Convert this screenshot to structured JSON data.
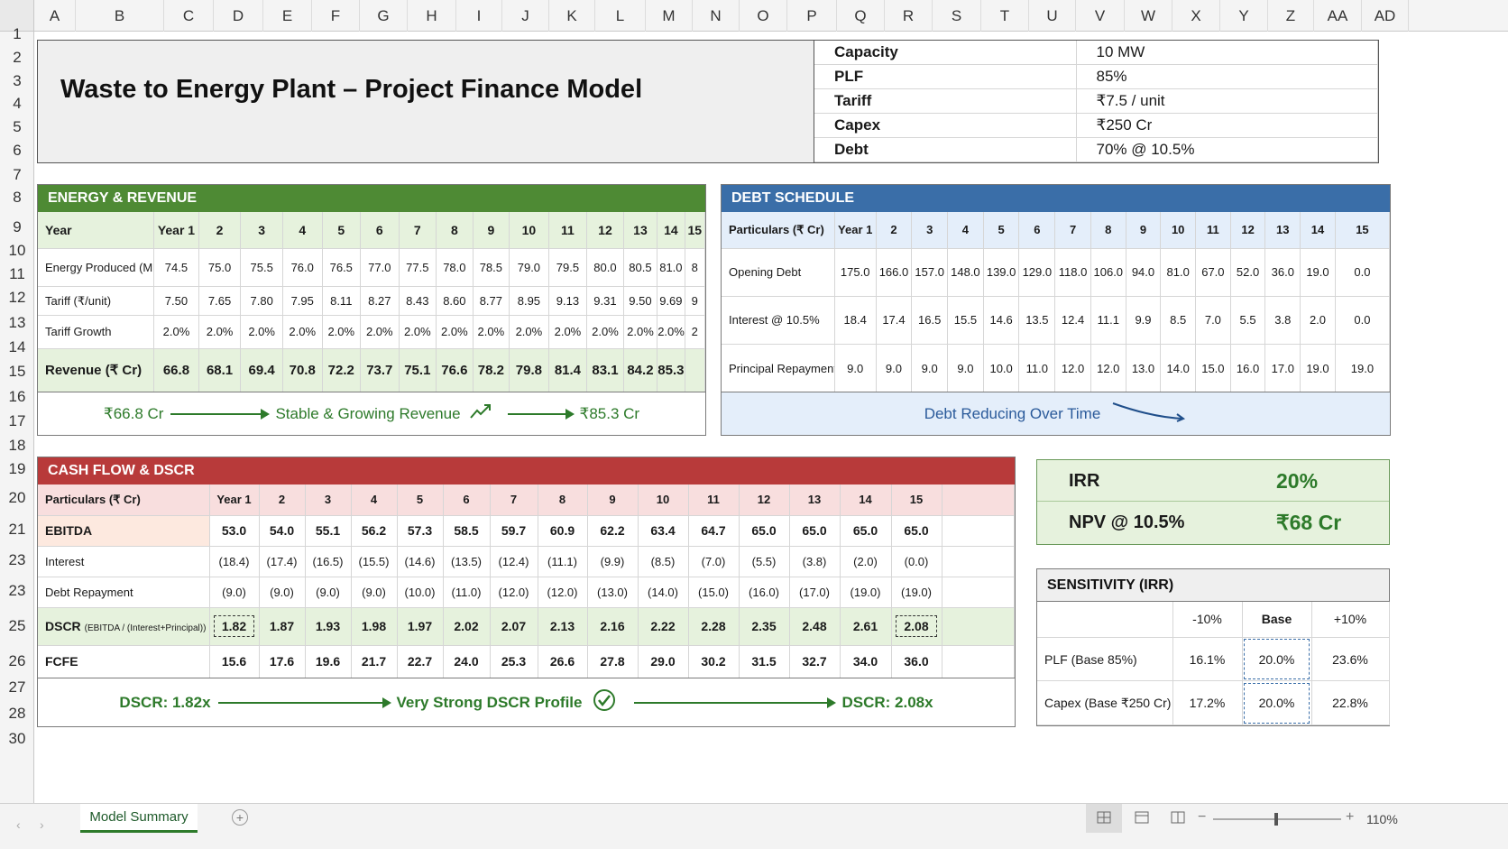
{
  "columns": [
    "A",
    "B",
    "C",
    "D",
    "E",
    "F",
    "G",
    "H",
    "I",
    "J",
    "K",
    "L",
    "M",
    "N",
    "O",
    "P",
    "Q",
    "R",
    "S",
    "T",
    "U",
    "V",
    "W",
    "X",
    "Y",
    "Z",
    "AA",
    "AD"
  ],
  "rows": [
    "1",
    "2",
    "3",
    "4",
    "5",
    "6",
    "7",
    "8",
    "9",
    "10",
    "11",
    "12",
    "13",
    "14",
    "15",
    "16",
    "17",
    "18",
    "19",
    "20",
    "21",
    "23",
    "23",
    "25",
    "26",
    "27",
    "28",
    "30"
  ],
  "title": "Waste to Energy Plant – Project Finance Model",
  "key_params": [
    {
      "label": "Capacity",
      "value": "10 MW"
    },
    {
      "label": "PLF",
      "value": "85%"
    },
    {
      "label": "Tariff",
      "value": "₹7.5 / unit"
    },
    {
      "label": "Capex",
      "value": "₹250 Cr"
    },
    {
      "label": "Debt",
      "value": "70% @ 10.5%"
    }
  ],
  "energy": {
    "header": "ENERGY & REVENUE",
    "cols": [
      "Year",
      "Year 1",
      "2",
      "3",
      "4",
      "5",
      "6",
      "7",
      "8",
      "9",
      "10",
      "11",
      "12",
      "13",
      "14",
      "15"
    ],
    "rows": [
      {
        "label": "Energy Produced (MU)",
        "values": [
          "74.5",
          "75.0",
          "75.5",
          "76.0",
          "76.5",
          "77.0",
          "77.5",
          "78.0",
          "78.5",
          "79.0",
          "79.5",
          "80.0",
          "80.5",
          "81.0",
          "8"
        ]
      },
      {
        "label": "Tariff (₹/unit)",
        "values": [
          "7.50",
          "7.65",
          "7.80",
          "7.95",
          "8.11",
          "8.27",
          "8.43",
          "8.60",
          "8.77",
          "8.95",
          "9.13",
          "9.31",
          "9.50",
          "9.69",
          "9"
        ]
      },
      {
        "label": "Tariff Growth",
        "values": [
          "2.0%",
          "2.0%",
          "2.0%",
          "2.0%",
          "2.0%",
          "2.0%",
          "2.0%",
          "2.0%",
          "2.0%",
          "2.0%",
          "2.0%",
          "2.0%",
          "2.0%",
          "2.0%",
          "2"
        ]
      }
    ],
    "revenue": {
      "label": "Revenue (₹ Cr)",
      "values": [
        "66.8",
        "68.1",
        "69.4",
        "70.8",
        "72.2",
        "73.7",
        "75.1",
        "76.6",
        "78.2",
        "79.8",
        "81.4",
        "83.1",
        "84.2",
        "85.3",
        ""
      ]
    },
    "footer": {
      "left": "₹66.8 Cr",
      "mid": "Stable & Growing Revenue",
      "right": "₹85.3 Cr",
      "icon": "trend-up-icon"
    }
  },
  "debt": {
    "header": "DEBT SCHEDULE",
    "cols": [
      "Particulars (₹ Cr)",
      "Year 1",
      "2",
      "3",
      "4",
      "5",
      "6",
      "7",
      "8",
      "9",
      "10",
      "11",
      "12",
      "13",
      "14",
      "15"
    ],
    "rows": [
      {
        "label": "Opening Debt",
        "values": [
          "175.0",
          "166.0",
          "157.0",
          "148.0",
          "139.0",
          "129.0",
          "118.0",
          "106.0",
          "94.0",
          "81.0",
          "67.0",
          "52.0",
          "36.0",
          "19.0",
          "0.0"
        ]
      },
      {
        "label": "Interest @ 10.5%",
        "values": [
          "18.4",
          "17.4",
          "16.5",
          "15.5",
          "14.6",
          "13.5",
          "12.4",
          "11.1",
          "9.9",
          "8.5",
          "7.0",
          "5.5",
          "3.8",
          "2.0",
          "0.0"
        ]
      },
      {
        "label": "Principal Repayment",
        "values": [
          "9.0",
          "9.0",
          "9.0",
          "9.0",
          "10.0",
          "11.0",
          "12.0",
          "12.0",
          "13.0",
          "14.0",
          "15.0",
          "16.0",
          "17.0",
          "19.0",
          "19.0"
        ]
      }
    ],
    "footer": "Debt Reducing Over Time",
    "icon": "trend-down-icon"
  },
  "cashflow": {
    "header": "CASH FLOW & DSCR",
    "cols": [
      "Particulars (₹ Cr)",
      "Year 1",
      "2",
      "3",
      "4",
      "5",
      "6",
      "7",
      "8",
      "9",
      "10",
      "11",
      "12",
      "13",
      "14",
      "15"
    ],
    "rows": [
      {
        "label": "EBITDA",
        "bold": true,
        "values": [
          "53.0",
          "54.0",
          "55.1",
          "56.2",
          "57.3",
          "58.5",
          "59.7",
          "60.9",
          "62.2",
          "63.4",
          "64.7",
          "65.0",
          "65.0",
          "65.0",
          "65.0"
        ]
      },
      {
        "label": "Interest",
        "values": [
          "(18.4)",
          "(17.4)",
          "(16.5)",
          "(15.5)",
          "(14.6)",
          "(13.5)",
          "(12.4)",
          "(11.1)",
          "(9.9)",
          "(8.5)",
          "(7.0)",
          "(5.5)",
          "(3.8)",
          "(2.0)",
          "(0.0)"
        ]
      },
      {
        "label": "Debt Repayment",
        "values": [
          "(9.0)",
          "(9.0)",
          "(9.0)",
          "(9.0)",
          "(10.0)",
          "(11.0)",
          "(12.0)",
          "(12.0)",
          "(13.0)",
          "(14.0)",
          "(15.0)",
          "(16.0)",
          "(17.0)",
          "(19.0)",
          "(19.0)"
        ]
      }
    ],
    "dscr": {
      "label": "DSCR",
      "note": "(EBITDA / (Interest+Principal))",
      "values": [
        "1.82",
        "1.87",
        "1.93",
        "1.98",
        "1.97",
        "2.02",
        "2.07",
        "2.13",
        "2.16",
        "2.22",
        "2.28",
        "2.35",
        "2.48",
        "2.61",
        "2.08"
      ]
    },
    "fcfe": {
      "label": "FCFE",
      "values": [
        "15.6",
        "17.6",
        "19.6",
        "21.7",
        "22.7",
        "24.0",
        "25.3",
        "26.6",
        "27.8",
        "29.0",
        "30.2",
        "31.5",
        "32.7",
        "34.0",
        "36.0"
      ]
    },
    "footer": {
      "left": "DSCR: 1.82x",
      "mid": "Very Strong DSCR Profile",
      "right": "DSCR: 2.08x",
      "icon": "check-circle-icon"
    }
  },
  "returns": [
    {
      "label": "IRR",
      "value": "20%"
    },
    {
      "label": "NPV @ 10.5%",
      "value": "₹68 Cr"
    }
  ],
  "sensitivity": {
    "header": "SENSITIVITY (IRR)",
    "cols": [
      "",
      "-10%",
      "Base",
      "+10%"
    ],
    "rows": [
      {
        "label": "PLF (Base 85%)",
        "values": [
          "16.1%",
          "20.0%",
          "23.6%"
        ]
      },
      {
        "label": "Capex (Base ₹250 Cr)",
        "values": [
          "17.2%",
          "20.0%",
          "22.8%"
        ]
      }
    ]
  },
  "sheet_tab": "Model Summary",
  "zoom": "110%",
  "colors": {
    "green": "#4e8a34",
    "blue": "#3a6ea8",
    "red": "#b83a3a",
    "light_green": "#e6f2dd",
    "light_blue": "#e4eefa",
    "light_red": "#f8dede"
  }
}
